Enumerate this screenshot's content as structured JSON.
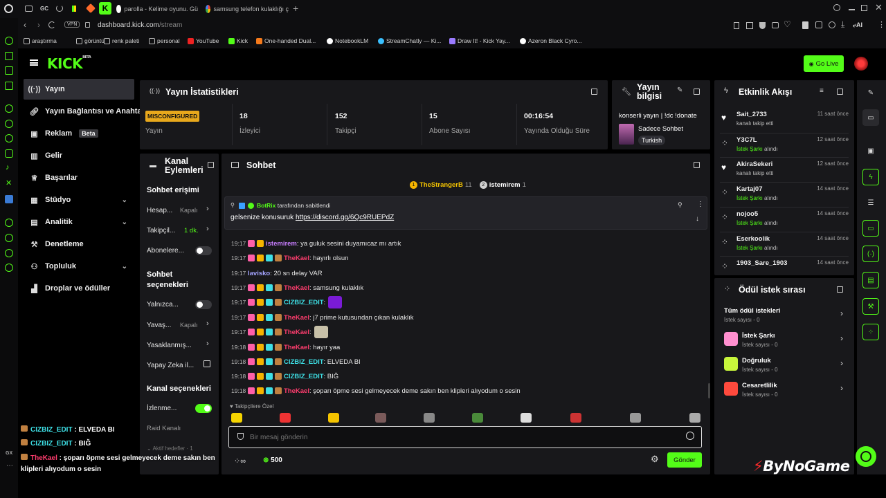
{
  "browser": {
    "tabs": [
      {
        "label": "parolla - Kelime oyunu. Gü"
      },
      {
        "label": "samsung telefon kulaklığı ç"
      }
    ],
    "tab_small_labels": {
      "gc": "GC"
    },
    "url_host": "dashboard.kick.com",
    "url_path": "/stream",
    "vpn": "VPN",
    "ai": "AI",
    "bookmarks": [
      "araştırma",
      "görüntü",
      "renk paleti",
      "personal",
      "YouTube",
      "Kick",
      "One-handed Dual...",
      "NotebookLM",
      "StreamChatly — Ki...",
      "Draw It! - Kick Yay...",
      "Azeron Black Cyro..."
    ],
    "gx": "GX"
  },
  "kick": {
    "logo": "KICK",
    "logo_sup": "BETA",
    "go_live": "Go Live"
  },
  "nav": {
    "items": [
      {
        "label": "Yayın",
        "icon": "broadcast-icon",
        "active": true
      },
      {
        "label": "Yayın Bağlantısı ve Anahtar",
        "icon": "link-icon"
      },
      {
        "label": "Reklam",
        "icon": "ad-icon",
        "badge": "Beta"
      },
      {
        "label": "Gelir",
        "icon": "chart-icon"
      },
      {
        "label": "Başarılar",
        "icon": "trophy-icon"
      },
      {
        "label": "Stüdyo",
        "icon": "studio-icon",
        "chevron": true
      },
      {
        "label": "Analitik",
        "icon": "analytics-icon",
        "chevron": true
      },
      {
        "label": "Denetleme",
        "icon": "hammer-icon"
      },
      {
        "label": "Topluluk",
        "icon": "community-icon",
        "chevron": true
      },
      {
        "label": "Droplar ve ödüller",
        "icon": "drops-icon"
      }
    ]
  },
  "stats": {
    "title": "Yayın İstatistikleri",
    "status_badge": "MISCONFIGURED",
    "status_label": "Yayın",
    "viewers": "18",
    "viewers_label": "İzleyici",
    "followers": "152",
    "followers_label": "Takipçi",
    "subs": "15",
    "subs_label": "Abone Sayısı",
    "uptime": "00:16:54",
    "uptime_label": "Yayında Olduğu Süre"
  },
  "stream_info": {
    "title_line1": "Yayın",
    "title_line2": "bilgisi",
    "stream_title": "konserli yayın | !dc !donate",
    "category": "Sadece Sohbet",
    "language": "Turkish"
  },
  "channel_actions": {
    "title_line1": "Kanal",
    "title_line2": "Eylemleri",
    "chat_access": "Sohbet erişimi",
    "account_age": "Hesap...",
    "account_age_val": "Kapalı",
    "followers_only": "Takipçil...",
    "followers_only_val": "1 dk.",
    "subs_only": "Abonelere...",
    "chat_options_1": "Sohbet",
    "chat_options_2": "seçenekleri",
    "only": "Yalnızca...",
    "slow": "Yavaş...",
    "slow_val": "Kapalı",
    "banned": "Yasaklanmış...",
    "ai": "Yapay Zeka il...",
    "channel_options": "Kanal seçenekleri",
    "watch": "İzlenme...",
    "raid": "Raid Kanalı",
    "goals": "Aktif hedefler · 1"
  },
  "chat": {
    "title": "Sohbet",
    "top_users": [
      {
        "name": "TheStrangerB",
        "count": "11",
        "rank": "1"
      },
      {
        "name": "istemirem",
        "count": "1",
        "rank": "2"
      }
    ],
    "pinned_by": "BotRix",
    "pinned_suffix": "tarafından sabitlendi",
    "pinned_text": "gelsenize konusuruk",
    "pinned_link": "https://discord.gg/6Qc9RUEPdZ",
    "messages": [
      {
        "time": "19:17",
        "user": "istemirem",
        "color": "#c77dff",
        "text": ": ya guluk sesini duyamıcaz mı artık"
      },
      {
        "time": "19:17",
        "user": "TheKael",
        "color": "#ff3d6e",
        "text": ": hayırlı olsun"
      },
      {
        "time": "19:17",
        "user": "lavisko",
        "color": "#a3a3ff",
        "text": ": 20 sn delay VAR"
      },
      {
        "time": "19:17",
        "user": "TheKael",
        "color": "#ff3d6e",
        "text": ": samsung kulaklık"
      },
      {
        "time": "19:17",
        "user": "CIZBIZ_EDIT",
        "color": "#3ee0e6",
        "text": ": "
      },
      {
        "time": "19:17",
        "user": "TheKael",
        "color": "#ff3d6e",
        "text": ": j7 prime kutusundan çıkan kulaklık"
      },
      {
        "time": "19:17",
        "user": "TheKael",
        "color": "#ff3d6e",
        "text": ": "
      },
      {
        "time": "19:18",
        "user": "TheKael",
        "color": "#ff3d6e",
        "text": ": hayır yaa"
      },
      {
        "time": "19:18",
        "user": "CIZBIZ_EDIT",
        "color": "#3ee0e6",
        "text": ": ELVEDA BI"
      },
      {
        "time": "19:18",
        "user": "CIZBIZ_EDIT",
        "color": "#3ee0e6",
        "text": ": BIĞ"
      },
      {
        "time": "19:18",
        "user": "TheKael",
        "color": "#ff3d6e",
        "text": ": şoparı öpme sesi gelmeyecek deme sakın ben klipleri alıyodum o sesin"
      }
    ],
    "followers_special": "Takipçilere Özel",
    "input_placeholder": "Bir mesaj gönderin",
    "points": "500",
    "send": "Gönder"
  },
  "events": {
    "title": "Etkinlik Akışı",
    "items": [
      {
        "name": "Sait_2733",
        "desc": "kanalı takip etti",
        "time": "11 saat önce",
        "type": "follow"
      },
      {
        "name": "Y3C7L",
        "desc_green": "İstek Şarkı",
        "desc": " alındı",
        "time": "12 saat önce",
        "type": "reward"
      },
      {
        "name": "AkiraSekeri",
        "desc": "kanalı takip etti",
        "time": "12 saat önce",
        "type": "follow"
      },
      {
        "name": "Kartaj07",
        "desc_green": "İstek Şarkı",
        "desc": " alındı",
        "time": "14 saat önce",
        "type": "reward"
      },
      {
        "name": "nojoo5",
        "desc_green": "İstek Şarkı",
        "desc": " alındı",
        "time": "14 saat önce",
        "type": "reward"
      },
      {
        "name": "Eserkoolik",
        "desc_green": "İstek Şarkı",
        "desc": " alındı",
        "time": "14 saat önce",
        "type": "reward"
      },
      {
        "name": "1903_Sare_1903",
        "desc": "",
        "time": "14 saat önce",
        "type": "reward"
      }
    ]
  },
  "rewards": {
    "title": "Ödül istek sırası",
    "all": "Tüm ödül istekleri",
    "all_count": "İstek sayısı - 0",
    "items": [
      {
        "name": "İstek Şarkı",
        "count": "İstek sayısı - 0",
        "color": "#ff8fcf"
      },
      {
        "name": "Doğruluk",
        "count": "İstek sayısı - 0",
        "color": "#c7f53b"
      },
      {
        "name": "Cesaretlilik",
        "count": "İstek sayısı - 0",
        "color": "#ff4a3d"
      }
    ]
  },
  "overlay": {
    "lines": [
      {
        "user": "CIZBIZ_EDIT",
        "text": " : ELVEDA BI",
        "color": "#3ee0e6"
      },
      {
        "user": "CIZBIZ_EDIT",
        "text": " : BIĞ",
        "color": "#3ee0e6"
      },
      {
        "user": "TheKael",
        "text": " : şoparı öpme sesi gelmeyecek deme sakın ben",
        "color": "#ff3d6e"
      }
    ],
    "line4": "klipleri alıyodum o sesin",
    "watermark": "ByNoGame"
  }
}
